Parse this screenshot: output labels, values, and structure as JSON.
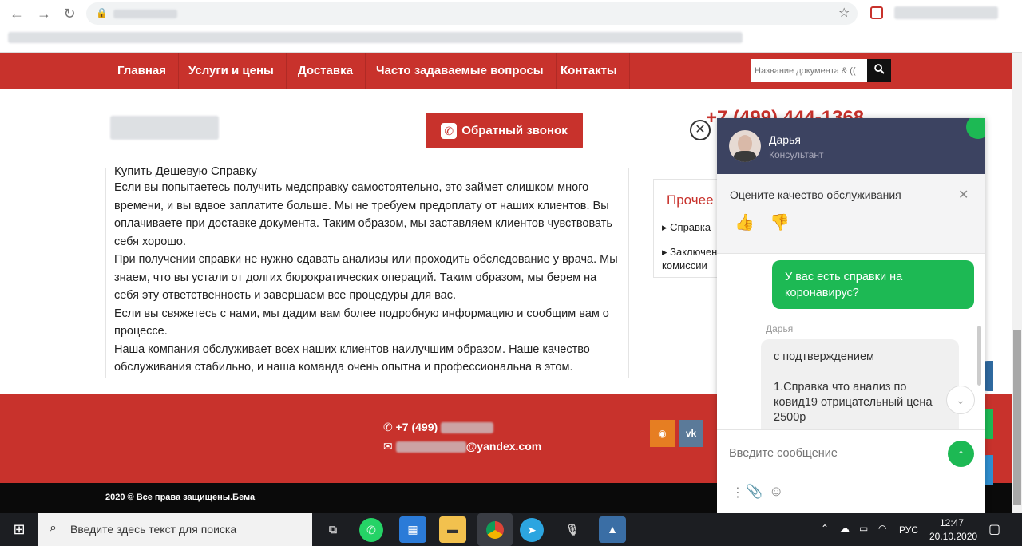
{
  "nav": {
    "items": [
      "Главная",
      "Услуги и цены",
      "Доставка",
      "Часто задаваемые вопросы",
      "Контакты"
    ],
    "search_placeholder": "Название документа & (("
  },
  "header": {
    "callback_label": "Обратный звонок",
    "phone": "+7 (499) 444-1368"
  },
  "article": {
    "title": "Купить Дешевую Справку",
    "paragraphs": [
      "Если вы попытаетесь получить медсправку самостоятельно, это займет слишком много времени, и вы вдвое заплатите больше. Мы не требуем предоплату от наших клиентов. Вы оплачиваете при доставке документа. Таким образом, мы заставляем клиентов чувствовать себя хорошо.",
      "При получении справки не нужно сдавать анализы или проходить обследование у врача. Мы знаем, что вы устали от долгих бюрократических операций. Таким образом, мы берем на себя эту ответственность и завершаем все процедуры для вас.",
      "Если вы свяжетесь с нами, мы дадим вам более подробную информацию и сообщим вам о процессе.",
      "Наша компания обслуживает всех наших клиентов наилучшим образом. Наше качество обслуживания стабильно, и наша команда очень опытна и профессиональна в этом."
    ]
  },
  "sidebar": {
    "title": "Прочее",
    "items": [
      "Справка",
      "Заключение",
      "комиссии"
    ]
  },
  "footer": {
    "phone": "+7 (499)",
    "email": "@yandex.com",
    "copyright": "2020 © Все права защищены.Бема",
    "social": [
      "rss",
      "vk"
    ]
  },
  "chat": {
    "agent_name": "Дарья",
    "agent_role": "Консультант",
    "rating_prompt": "Оцените качество обслуживания",
    "outgoing_message": "У вас есть справки на коронавирус?",
    "incoming_sender": "Дарья",
    "incoming_lines": [
      "с подтверждением",
      "",
      "1.Справка что анализ по ковид19 отрицательный цена 2500р"
    ],
    "input_placeholder": "Введите сообщение"
  },
  "taskbar": {
    "search_placeholder": "Введите здесь текст для поиска",
    "lang": "РУС",
    "time": "12:47",
    "date": "20.10.2020"
  },
  "colors": {
    "brand_red": "#c8322c",
    "chat_header": "#3c4361",
    "chat_green": "#1db954"
  }
}
